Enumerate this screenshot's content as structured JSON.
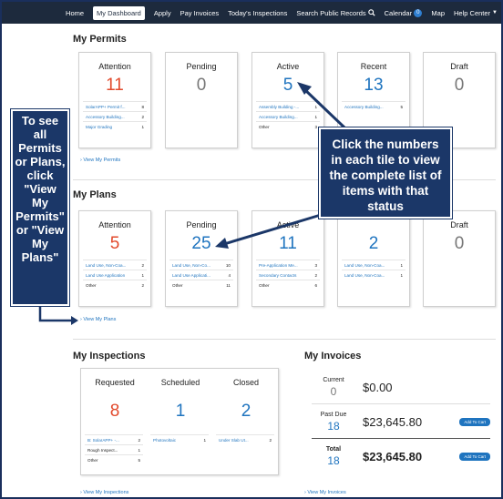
{
  "nav": {
    "items": [
      "Home",
      "My Dashboard",
      "Apply",
      "Pay Invoices",
      "Today's Inspections"
    ],
    "search_label": "Search Public Records",
    "calendar_label": "Calendar",
    "calendar_badge": "0",
    "map_label": "Map",
    "help_label": "Help Center"
  },
  "permits": {
    "title": "My Permits",
    "tiles": [
      {
        "label": "Attention",
        "count": "11",
        "rows": [
          [
            "SolarAPP+ Permit f...",
            "8"
          ],
          [
            "Accessory Building...",
            "2"
          ],
          [
            "Major Grading",
            "1"
          ]
        ]
      },
      {
        "label": "Pending",
        "count": "0"
      },
      {
        "label": "Active",
        "count": "5",
        "rows": [
          [
            "Assembly Building -...",
            "1"
          ],
          [
            "Accessory Building...",
            "1"
          ],
          [
            "Other",
            "3"
          ]
        ]
      },
      {
        "label": "Recent",
        "count": "13",
        "rows": [
          [
            "Accessory Building...",
            "5"
          ]
        ]
      },
      {
        "label": "Draft",
        "count": "0"
      }
    ],
    "view_link": "› View My Permits"
  },
  "plans": {
    "title": "My Plans",
    "tiles": [
      {
        "label": "Attention",
        "count": "5",
        "rows": [
          [
            "Land Use, Non-Coa...",
            "2"
          ],
          [
            "Land Use Application",
            "1"
          ],
          [
            "Other",
            "2"
          ]
        ]
      },
      {
        "label": "Pending",
        "count": "25",
        "rows": [
          [
            "Land Use, Non-Co...",
            "10"
          ],
          [
            "Land Use Applicati...",
            "4"
          ],
          [
            "Other",
            "11"
          ]
        ]
      },
      {
        "label": "Active",
        "count": "11",
        "rows": [
          [
            "Pre-Application Me...",
            "3"
          ],
          [
            "Secondary Contacts",
            "2"
          ],
          [
            "Other",
            "6"
          ]
        ]
      },
      {
        "label": "",
        "count": "2",
        "rows": [
          [
            "Land Use, Non-Coa...",
            "1"
          ],
          [
            "Land Use, Non-Coa...",
            "1"
          ]
        ]
      },
      {
        "label": "Draft",
        "count": "0"
      }
    ],
    "view_link": "› View My Plans"
  },
  "inspections": {
    "title": "My Inspections",
    "columns": [
      {
        "label": "Requested",
        "count": "8",
        "rows": [
          [
            "B: SolarAPP+ -...",
            "2"
          ],
          [
            "Rough Inspect...",
            "1"
          ],
          [
            "Other",
            "5"
          ]
        ]
      },
      {
        "label": "Scheduled",
        "count": "1",
        "rows": [
          [
            "Photovoltaic",
            "1"
          ]
        ]
      },
      {
        "label": "Closed",
        "count": "2",
        "rows": [
          [
            "Under Slab Ut...",
            "2"
          ]
        ]
      }
    ],
    "view_link": "› View My Inspections"
  },
  "invoices": {
    "title": "My Invoices",
    "rows": [
      {
        "label": "Current",
        "count": "0",
        "amount": "$0.00"
      },
      {
        "label": "Past Due",
        "count": "18",
        "amount": "$23,645.80",
        "button": "Add To Cart"
      },
      {
        "label": "Total",
        "count": "18",
        "amount": "$23,645.80",
        "button": "Add To Cart"
      }
    ],
    "view_link": "› View My Invoices"
  },
  "callouts": {
    "left": "To see all Permits or Plans, click \"View My Permits\" or \"View My Plans\"",
    "right": "Click the numbers in each tile to view the complete list of items with that status"
  },
  "colors": {
    "nav_bg": "#1d2a3d",
    "callout_bg": "#1b3768",
    "link": "#1f74bf",
    "attention": "#e24a2c"
  }
}
